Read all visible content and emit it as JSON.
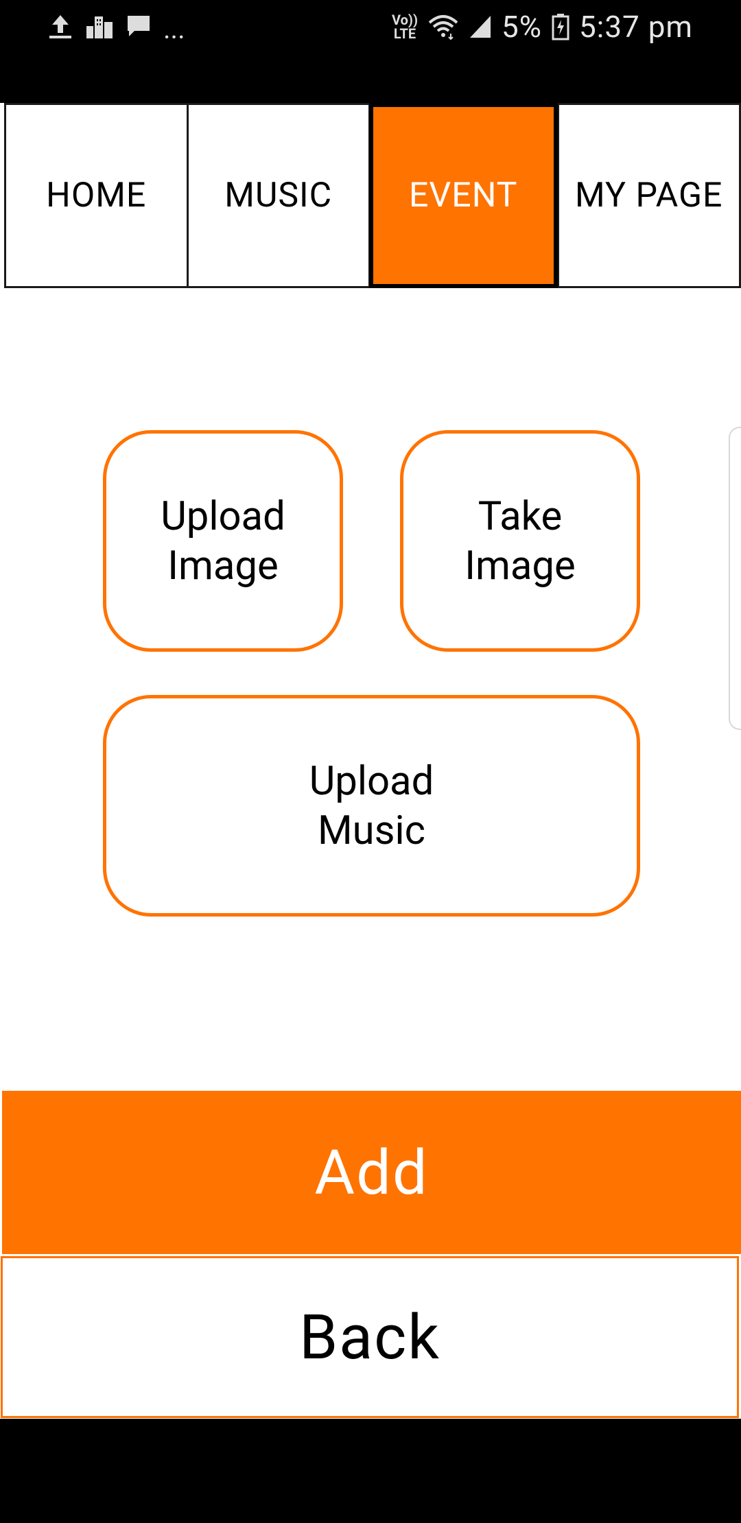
{
  "status_bar": {
    "battery": "5%",
    "time": "5:37 pm",
    "network_label_top": "Vo))",
    "network_label_bottom": "LTE",
    "overflow": "...",
    "icons": [
      "upload-icon",
      "city-icon",
      "chat-bubble-icon",
      "wifi-icon",
      "signal-icon",
      "battery-icon"
    ]
  },
  "tabs": [
    {
      "label": "HOME",
      "active": false
    },
    {
      "label": "MUSIC",
      "active": false
    },
    {
      "label": "EVENT",
      "active": true
    },
    {
      "label": "MY PAGE",
      "active": false
    }
  ],
  "options": {
    "upload_image": "Upload\nImage",
    "take_image": "Take\nImage",
    "upload_music": "Upload\nMusic"
  },
  "actions": {
    "add": "Add",
    "back": "Back"
  },
  "colors": {
    "accent": "#ff7300",
    "text": "#000000",
    "background": "#ffffff",
    "status_bar": "#000000"
  }
}
